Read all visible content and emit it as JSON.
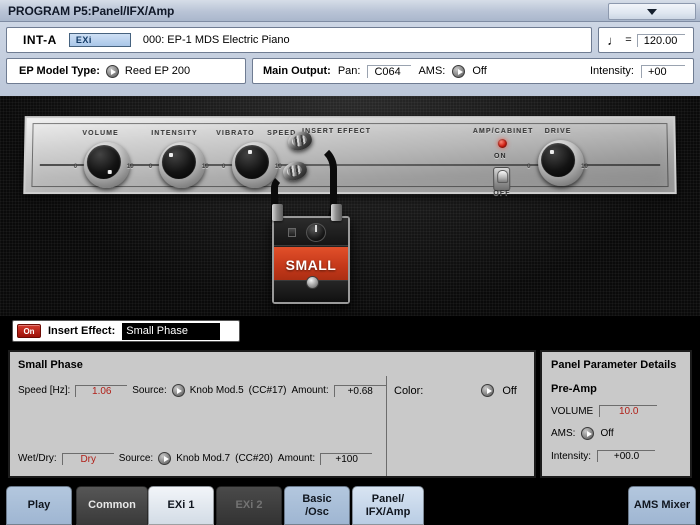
{
  "titlebar": {
    "title": "PROGRAM P5:Panel/IFX/Amp",
    "menu_icon": "chevron-down-icon"
  },
  "header": {
    "bank": "INT-A",
    "engine_badge": "EXi",
    "program_name": "000: EP-1 MDS Electric Piano",
    "tempo_note": "♩",
    "tempo_equals": "=",
    "tempo_value": "120.00",
    "ep_model_label": "EP Model Type:",
    "ep_model_value": "Reed EP 200",
    "main_output_label": "Main Output:",
    "pan_label": "Pan:",
    "pan_value": "C064",
    "ams_label": "AMS:",
    "ams_value": "Off",
    "intensity_label": "Intensity:",
    "intensity_value": "+00"
  },
  "amp_panel": {
    "knobs": [
      {
        "label": "VOLUME",
        "scale_min": "0",
        "scale_max": "10",
        "ticks": [
          "1",
          "2",
          "3",
          "4",
          "5",
          "6",
          "7",
          "8",
          "9"
        ]
      },
      {
        "label": "INTENSITY",
        "scale_min": "0",
        "scale_max": "10",
        "ticks": [
          "1",
          "2",
          "3",
          "4",
          "5",
          "6",
          "7",
          "8",
          "9"
        ]
      },
      {
        "label": "SPEED",
        "scale_min": "0",
        "scale_max": "10",
        "ticks": [
          "1",
          "2",
          "3",
          "4",
          "5",
          "6",
          "7",
          "8",
          "9"
        ]
      },
      {
        "label": "DRIVE",
        "scale_min": "0",
        "scale_max": "10",
        "ticks": [
          "1",
          "2",
          "3",
          "4",
          "5",
          "6",
          "7",
          "8",
          "9"
        ]
      }
    ],
    "vibrato_label": "VIBRATO",
    "insert_effect_label": "INSERT EFFECT",
    "amp_cabinet_label": "AMP/CABINET",
    "amp_on_label": "ON",
    "amp_off_label": "OFF",
    "pedal_name": "SMALL"
  },
  "insert_effect_bar": {
    "on_label": "On",
    "label": "Insert Effect:",
    "effect_name": "Small Phase"
  },
  "effect_panel": {
    "title": "Small Phase",
    "speed_label": "Speed [Hz]:",
    "speed_value": "1.06",
    "speed_source_label": "Source:",
    "speed_source_value": "Knob Mod.5",
    "speed_cc": "(CC#17)",
    "speed_amount_label": "Amount:",
    "speed_amount_value": "+0.68",
    "color_label": "Color:",
    "color_value": "Off",
    "wetdry_label": "Wet/Dry:",
    "wetdry_value": "Dry",
    "wetdry_source_label": "Source:",
    "wetdry_source_value": "Knob Mod.7",
    "wetdry_cc": "(CC#20)",
    "wetdry_amount_label": "Amount:",
    "wetdry_amount_value": "+100"
  },
  "panel_details": {
    "title": "Panel Parameter Details",
    "section": "Pre-Amp",
    "volume_label": "VOLUME",
    "volume_value": "10.0",
    "ams_label": "AMS:",
    "ams_value": "Off",
    "intensity_label": "Intensity:",
    "intensity_value": "+00.0"
  },
  "tabs": [
    {
      "line1": "Play",
      "line2": "",
      "state": "blue"
    },
    {
      "line1": "Common",
      "line2": "",
      "state": "dark"
    },
    {
      "line1": "EXi 1",
      "line2": "",
      "state": "selected"
    },
    {
      "line1": "EXi 2",
      "line2": "",
      "state": "disabled"
    },
    {
      "line1": "Basic",
      "line2": "/Osc",
      "state": "blue"
    },
    {
      "line1": "Panel/",
      "line2": "IFX/Amp",
      "state": "lightblue"
    },
    {
      "line1": "AMS Mixer",
      "line2": "",
      "state": "blue"
    }
  ],
  "colors": {
    "accent_blue": "#9fb6d2",
    "led_red": "#d01d10",
    "value_red": "#b02018",
    "pedal_orange": "#c4381a",
    "panel_gray": "#c9c9c9"
  }
}
